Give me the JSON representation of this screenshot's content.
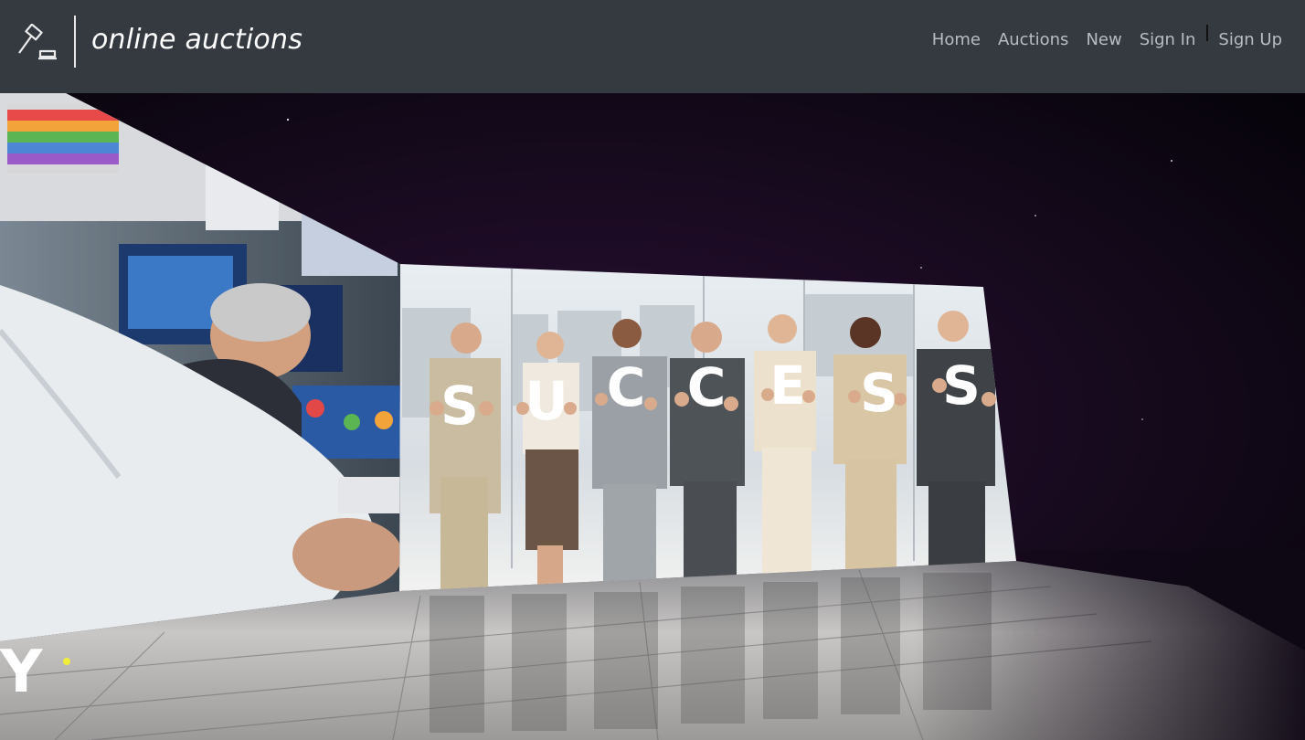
{
  "brand": {
    "logo_icon": "gavel-icon",
    "name": "online auctions"
  },
  "nav": {
    "home": "Home",
    "auctions": "Auctions",
    "new": "New",
    "sign_in": "Sign In",
    "sign_up": "Sign Up"
  },
  "hero": {
    "scene": "business-video-showcase",
    "letters": [
      "S",
      "U",
      "C",
      "C",
      "E",
      "S",
      "S"
    ],
    "corner_letter": "Y",
    "colors": {
      "background": "#0e0714",
      "floor": "#b8b6b4",
      "letter": "#ffffff"
    }
  }
}
